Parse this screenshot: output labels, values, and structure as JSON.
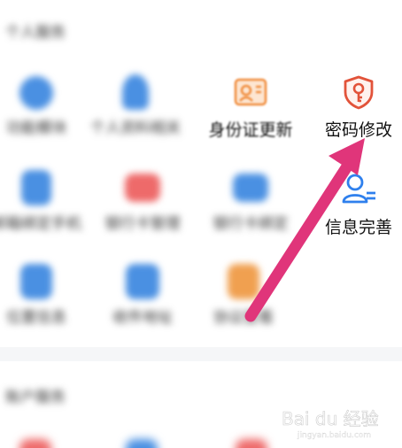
{
  "sections": {
    "personal_services_title": "个人服务",
    "account_services_title": "账户服务"
  },
  "grid": {
    "row1": [
      {
        "label": "功能模块",
        "icon": "globe-icon",
        "color": "#4a90e2"
      },
      {
        "label": "个人资料相关",
        "icon": "person-icon",
        "color": "#4a90e2"
      },
      {
        "label": "身份证更新",
        "icon": "id-card-icon",
        "color": "#f08c3c"
      },
      {
        "label": "密码修改",
        "icon": "shield-key-icon",
        "color": "#e2533a"
      }
    ],
    "row2": [
      {
        "label": "邮箱绑定手机",
        "icon": "badge-icon",
        "color": "#4a90e2"
      },
      {
        "label": "银行卡管理",
        "icon": "card-icon",
        "color": "#ee6a6a"
      },
      {
        "label": "银行卡绑定",
        "icon": "bank-card-icon",
        "color": "#4a90e2"
      },
      {
        "label": "信息完善",
        "icon": "user-edit-icon",
        "color": "#2f80ed"
      }
    ],
    "row3": [
      {
        "label": "位置信息",
        "icon": "doc-icon",
        "color": "#4a90e2"
      },
      {
        "label": "收件地址",
        "icon": "folder-icon",
        "color": "#4a90e2"
      },
      {
        "label": "协议查看",
        "icon": "note-icon",
        "color": "#f0a050"
      }
    ]
  },
  "watermark": {
    "text": "Bai du 经验",
    "subtext": "jingyan.baidu.com"
  },
  "annotation": {
    "arrow_color": "#e0357a"
  }
}
